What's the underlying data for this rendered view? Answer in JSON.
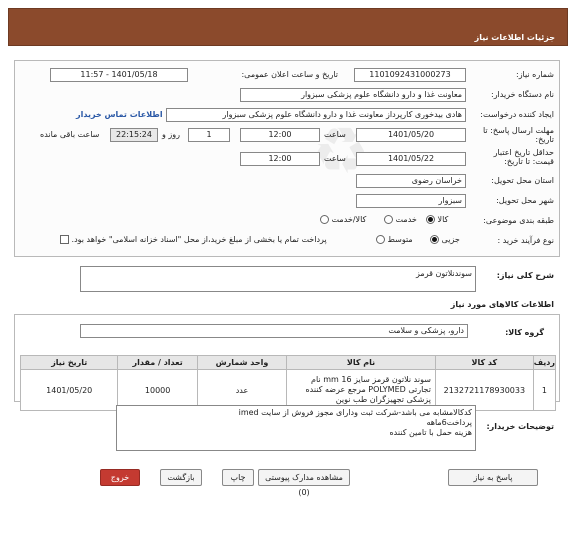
{
  "header": {
    "title": "جزئیات اطلاعات نیاز"
  },
  "form": {
    "need_number_label": "شماره نیاز:",
    "need_number": "1101092431000273",
    "announce_label": "تاریخ و ساعت اعلان عمومی:",
    "announce_value": "1401/05/18 - 11:57",
    "buyer_org_label": "نام دستگاه خریدار:",
    "buyer_org": "معاونت غذا و دارو   دانشگاه علوم پزشکی سبزوار",
    "creator_label": "ایجاد کننده درخواست:",
    "creator": "هادی بیدخوری کارپرداز معاونت غذا و دارو   دانشگاه علوم پزشکی سبزوار",
    "contact_link": "اطلاعات تماس خریدار",
    "deadline_label": "مهلت ارسال پاسخ: تا تاریخ:",
    "deadline_date": "1401/05/20",
    "time_label": "ساعت",
    "deadline_time": "12:00",
    "days_value": "1",
    "days_label": "روز و",
    "remaining_time": "22:15:24",
    "remaining_label": "ساعت باقی مانده",
    "validity_label": "حداقل تاریخ اعتبار قیمت: تا تاریخ:",
    "validity_date": "1401/05/22",
    "validity_time": "12:00",
    "province_label": "استان محل تحویل:",
    "province": "خراسان رضوی",
    "city_label": "شهر محل تحویل:",
    "city": "سبزوار",
    "category_label": "طبقه بندی موضوعی:",
    "category_options": [
      "کالا",
      "خدمت",
      "کالا/خدمت"
    ],
    "process_label": "نوع فرآیند خرید :",
    "process_options": [
      "جزیی",
      "متوسط"
    ],
    "payment_note": "پرداخت تمام یا بخشی از مبلغ خرید،از محل \"اسناد خزانه اسلامی\" خواهد بود."
  },
  "need_summary": {
    "label": "شرح کلی نیاز:",
    "value": "سوندنلاتون قرمز"
  },
  "goods": {
    "section_title": "اطلاعات کالاهای مورد نیاز",
    "group_label": "گروه کالا:",
    "group_value": "دارو، پزشکی و سلامت",
    "columns": [
      "ردیف",
      "کد کالا",
      "نام کالا",
      "واحد شمارش",
      "تعداد / مقدار",
      "تاریخ نیاز"
    ],
    "rows": [
      {
        "row": "1",
        "code": "2132721178930033",
        "name": "سوند نلاتون قرمز سایز 16 mm نام تجارتی POLYMED مرجع عرضه کننده پزشکی تجهیزگران طب نوین",
        "unit": "عدد",
        "qty": "10000",
        "date": "1401/05/20"
      }
    ]
  },
  "buyer_notes": {
    "label": "توضیحات خریدار:",
    "lines": [
      "کدکالامشابه می باشد-شرکت ثبت ودارای مجوز فروش از سایت imed",
      "پرداخت6ماهه",
      "هزینه حمل با تامین کننده"
    ]
  },
  "buttons": {
    "reply": "پاسخ به نیاز",
    "attachments": "مشاهده مدارک پیوستی (0)",
    "print": "چاپ",
    "back": "بازگشت",
    "exit": "خروج"
  }
}
